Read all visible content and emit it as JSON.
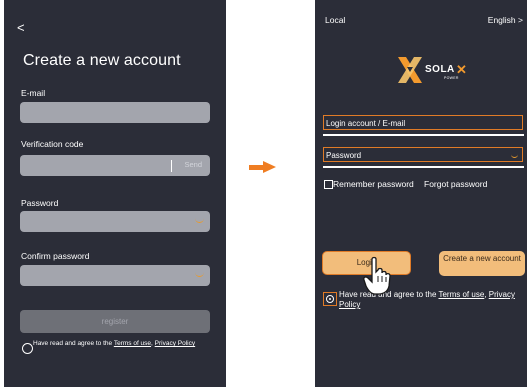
{
  "register_screen": {
    "back_label": "<",
    "title": "Create a new account",
    "email_label": "E-mail",
    "verification_label": "Verification code",
    "send_label": "Send",
    "password_label": "Password",
    "confirm_password_label": "Confirm password",
    "register_label": "register",
    "agree_prefix": "Have read and agree to the ",
    "terms_link": "Terms of use",
    "agree_sep": ", ",
    "privacy_link": "Privacy Policy"
  },
  "login_screen": {
    "local_label": "Local",
    "language_label": "English >",
    "logo_text": "SOLA",
    "logo_subtext": "POWER",
    "account_placeholder": "Login account / E-mail",
    "password_placeholder": "Password",
    "remember_label": "Remember password",
    "forgot_label": "Forgot password",
    "login_label": "Login",
    "create_account_label": "Create a new account",
    "agree_prefix": "Have read and agree to the ",
    "terms_link": "Terms of use",
    "agree_sep": ", ",
    "privacy_link": "Privacy Policy"
  },
  "colors": {
    "background": "#2b2d38",
    "accent": "#ef7d22",
    "button": "#f2bd7b",
    "field": "#a3a5ad"
  },
  "icons": [
    "back-icon",
    "eye-icon",
    "arrow-right-icon",
    "solax-logo-icon",
    "pointer-hand-icon"
  ]
}
